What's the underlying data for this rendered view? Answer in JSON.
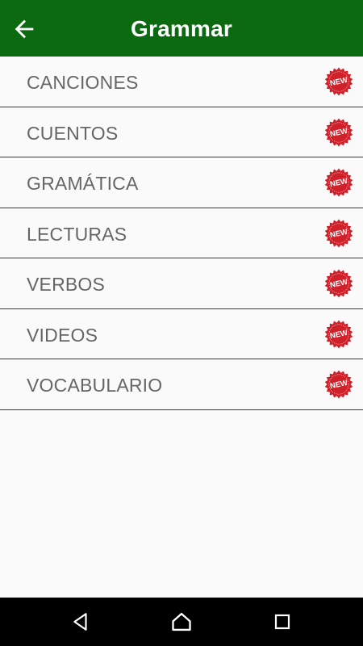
{
  "app_bar": {
    "title": "Grammar",
    "back_icon": "arrow-left-icon",
    "background_color": "#0b690f"
  },
  "badge": {
    "label": "NEW",
    "color": "#d0202a",
    "icon": "new-starburst-icon"
  },
  "list": {
    "items": [
      {
        "label": "CANCIONES",
        "badge": "NEW"
      },
      {
        "label": "CUENTOS",
        "badge": "NEW"
      },
      {
        "label": "GRAMÁTICA",
        "badge": "NEW"
      },
      {
        "label": "LECTURAS",
        "badge": "NEW"
      },
      {
        "label": "VERBOS",
        "badge": "NEW"
      },
      {
        "label": "VIDEOS",
        "badge": "NEW"
      },
      {
        "label": "VOCABULARIO",
        "badge": "NEW"
      }
    ]
  },
  "nav_bar": {
    "back_icon": "triangle-back-icon",
    "home_icon": "circle-home-icon",
    "recents_icon": "square-recents-icon"
  }
}
